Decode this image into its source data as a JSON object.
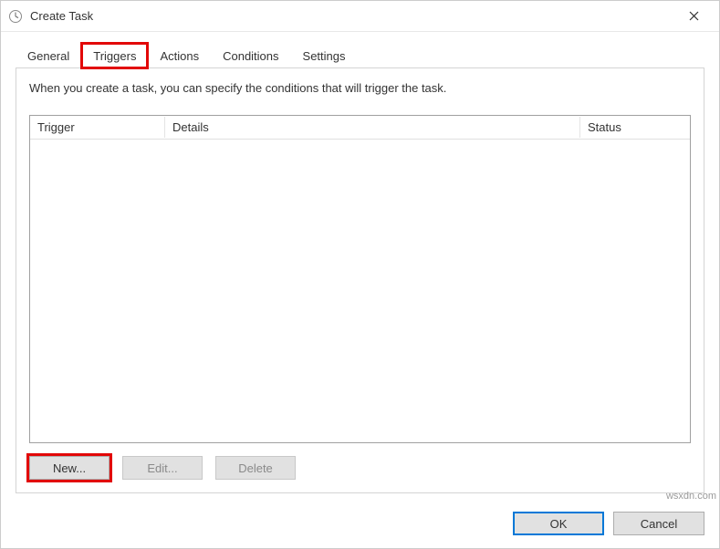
{
  "window": {
    "title": "Create Task"
  },
  "tabs": {
    "general": "General",
    "triggers": "Triggers",
    "actions": "Actions",
    "conditions": "Conditions",
    "settings": "Settings"
  },
  "panel": {
    "description": "When you create a task, you can specify the conditions that will trigger the task."
  },
  "table": {
    "headers": {
      "trigger": "Trigger",
      "details": "Details",
      "status": "Status"
    }
  },
  "buttons": {
    "new": "New...",
    "edit": "Edit...",
    "delete": "Delete",
    "ok": "OK",
    "cancel": "Cancel"
  },
  "watermark": "wsxdn.com"
}
